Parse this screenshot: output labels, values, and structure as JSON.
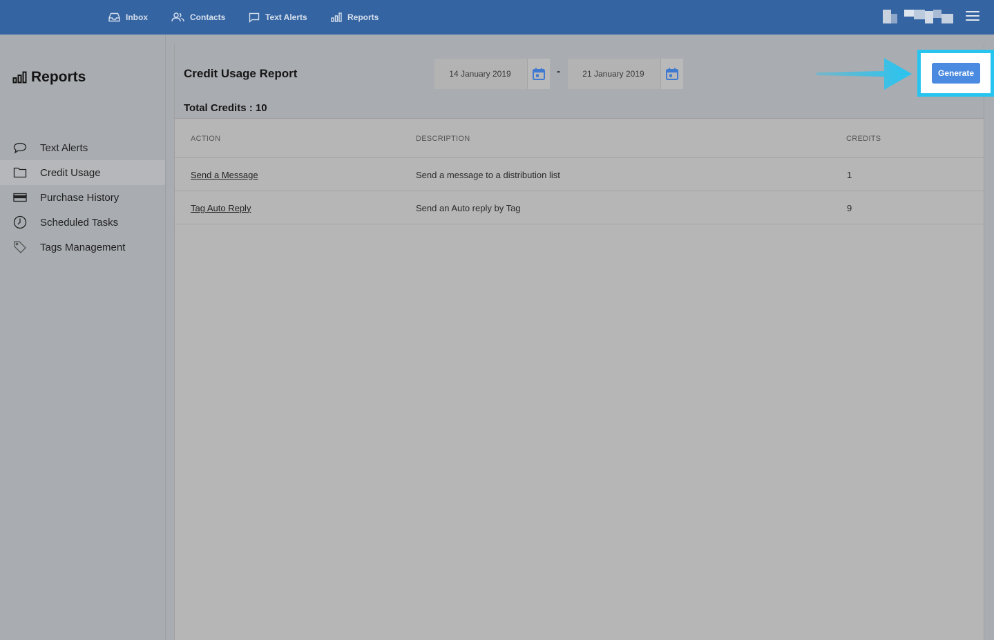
{
  "nav": {
    "items": [
      {
        "label": "Inbox",
        "icon": "inbox-icon"
      },
      {
        "label": "Contacts",
        "icon": "contacts-icon"
      },
      {
        "label": "Text Alerts",
        "icon": "chat-bubble-icon"
      },
      {
        "label": "Reports",
        "icon": "bar-chart-icon"
      }
    ]
  },
  "sidebar": {
    "title": "Reports",
    "items": [
      {
        "label": "Text Alerts",
        "icon": "chat-bubble-icon"
      },
      {
        "label": "Credit Usage",
        "icon": "folder-icon",
        "active": true
      },
      {
        "label": "Purchase History",
        "icon": "credit-card-icon"
      },
      {
        "label": "Scheduled Tasks",
        "icon": "clock-icon"
      },
      {
        "label": "Tags Management",
        "icon": "tag-icon"
      }
    ]
  },
  "report": {
    "title": "Credit Usage Report",
    "total_credits": "Total Credits : 10",
    "start_date": "14 January 2019",
    "end_date": "21 January 2019",
    "date_separator": "-",
    "generate_label": "Generate"
  },
  "table": {
    "headers": [
      "ACTION",
      "DESCRIPTION",
      "CREDITS"
    ],
    "rows": [
      {
        "action": "Send a Message",
        "description": "Send a message to a distribution list",
        "credits": "1"
      },
      {
        "action": "Tag Auto Reply",
        "description": "Send an Auto reply by Tag",
        "credits": "9"
      }
    ]
  },
  "colors": {
    "navbar": "#3464a2",
    "accent": "#4a8ae0",
    "highlight": "#28c4f0"
  }
}
